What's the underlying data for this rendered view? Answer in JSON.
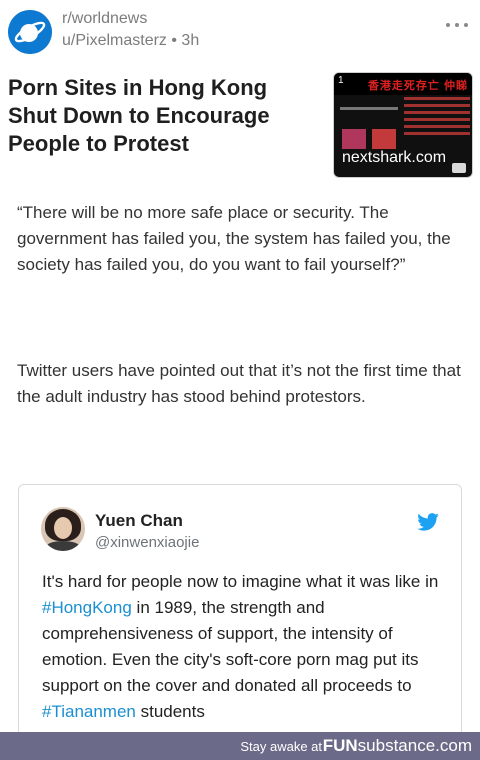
{
  "post": {
    "subreddit": "r/worldnews",
    "meta": "u/Pixelmasterz • 3h",
    "more_icon": "more-dots-icon",
    "title": "Porn Sites in Hong Kong Shut Down to Encourage People to Protest",
    "thumbnail": {
      "domain": "nextshark.com",
      "corner_number": "1",
      "headline": "香港走死存亡 仲睇"
    }
  },
  "body": {
    "paragraph1": "“There will be no more safe place or security. The government has failed you, the system has failed you, the society has failed you, do you want to fail yourself?”",
    "paragraph2": "Twitter users have pointed out that it’s not the first time that the adult industry has stood behind protestors."
  },
  "tweet": {
    "name": "Yuen Chan",
    "handle": "@xinwenxiaojie",
    "icon": "twitter-bird-icon",
    "text_part1": "It's hard for people now to imagine what it was like in ",
    "hashtag1": "#HongKong",
    "text_part2": " in 1989, the strength and comprehensiveness of support, the intensity of emotion. Even the city's soft-core porn mag put its support on the cover and donated all proceeds to ",
    "hashtag2": "#Tiananmen",
    "text_part3": " students"
  },
  "footer": {
    "stay": "Stay awake at",
    "brand_bold": "FUN",
    "brand_main": "substance",
    "brand_tld": ".com"
  },
  "colors": {
    "subreddit_icon": "#0d79d0",
    "link": "#1b8fd1",
    "footer_bg": "#6b6a89"
  }
}
